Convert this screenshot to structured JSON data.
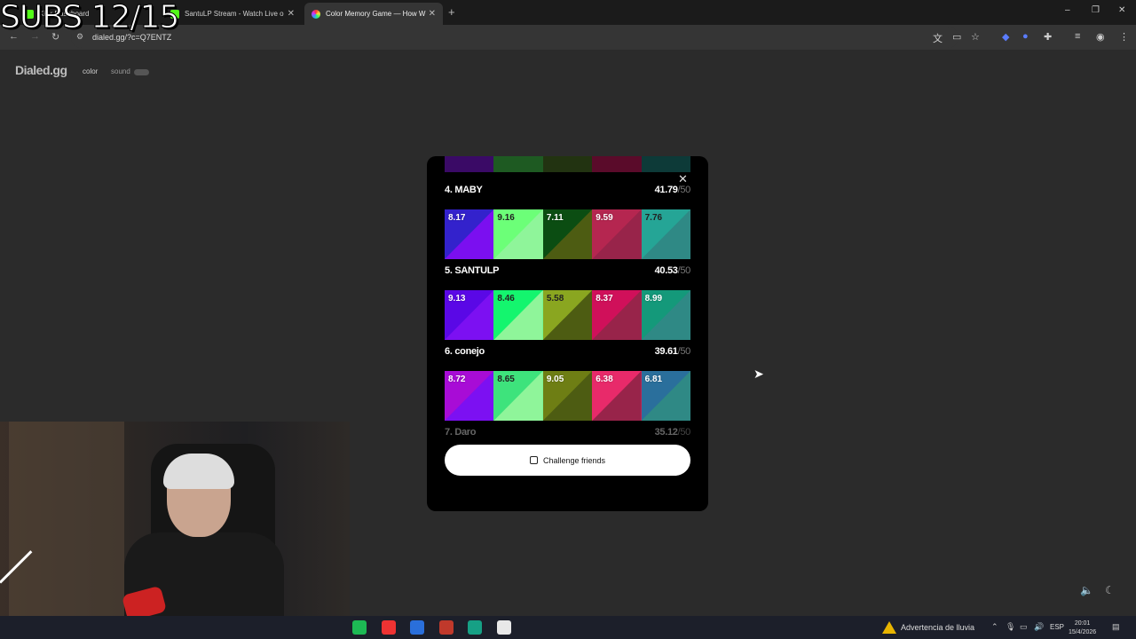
{
  "overlay": {
    "subs_text": "SUBS 12/15"
  },
  "browser": {
    "tabs": [
      {
        "label": "Kick Dashboard"
      },
      {
        "label": "SantuLP Stream - Watch Live o"
      },
      {
        "label": "Color Memory Game — How W"
      }
    ],
    "new_tab": "+",
    "address": "dialed.gg/?c=Q7ENTZ",
    "window_controls": {
      "minimize": "–",
      "restore": "❐",
      "close": "✕"
    }
  },
  "site": {
    "logo": "Dialed.gg",
    "nav_color": "color",
    "nav_sound": "sound"
  },
  "leaderboard": {
    "peek_colors": [
      "#3a0a66",
      "#1e5a22",
      "#223311",
      "#5a0b2a",
      "#0d3a38"
    ],
    "entries": [
      {
        "rank_name": "4. MABY",
        "score": "41.79",
        "of": "/50",
        "swatches": [
          {
            "value": "8.17",
            "a": "#3322cc",
            "b": "#7b0ff0",
            "dark": false
          },
          {
            "value": "9.16",
            "a": "#6cff78",
            "b": "#8ff59a",
            "dark": true
          },
          {
            "value": "7.11",
            "a": "#0b4d12",
            "b": "#4d5c12",
            "dark": false
          },
          {
            "value": "9.59",
            "a": "#b52650",
            "b": "#98244a",
            "dark": false
          },
          {
            "value": "7.76",
            "a": "#25a596",
            "b": "#2f8985",
            "dark": true
          }
        ]
      },
      {
        "rank_name": "5. SANTULP",
        "score": "40.53",
        "of": "/50",
        "swatches": [
          {
            "value": "9.13",
            "a": "#5a08e6",
            "b": "#7c10f2",
            "dark": false
          },
          {
            "value": "8.46",
            "a": "#14f56e",
            "b": "#8ff59a",
            "dark": true
          },
          {
            "value": "5.58",
            "a": "#8aa620",
            "b": "#4d5c12",
            "dark": true
          },
          {
            "value": "8.37",
            "a": "#d0105a",
            "b": "#98244a",
            "dark": false
          },
          {
            "value": "8.99",
            "a": "#14997a",
            "b": "#2f8985",
            "dark": false
          }
        ]
      },
      {
        "rank_name": "6. conejo",
        "score": "39.61",
        "of": "/50",
        "swatches": [
          {
            "value": "8.72",
            "a": "#a80cd6",
            "b": "#7c10f2",
            "dark": false
          },
          {
            "value": "8.65",
            "a": "#3ee37c",
            "b": "#8ff59a",
            "dark": true
          },
          {
            "value": "9.05",
            "a": "#6e7e14",
            "b": "#4d5c12",
            "dark": false
          },
          {
            "value": "6.38",
            "a": "#e82a6a",
            "b": "#98244a",
            "dark": false
          },
          {
            "value": "6.81",
            "a": "#2a6f9c",
            "b": "#2f8985",
            "dark": false
          }
        ]
      },
      {
        "rank_name": "7. Daro",
        "score": "35.12",
        "of": "/50"
      }
    ],
    "close_symbol": "✕",
    "challenge_label": "Challenge friends"
  },
  "taskbar": {
    "weather": "Advertencia de lluvia",
    "lang": "ESP",
    "time": "20:01",
    "date": "15/4/2026",
    "app_colors": [
      "#1db954",
      "#e33",
      "#2a6fdb",
      "#c0392b",
      "#16a085",
      "#e8e8e8"
    ]
  }
}
